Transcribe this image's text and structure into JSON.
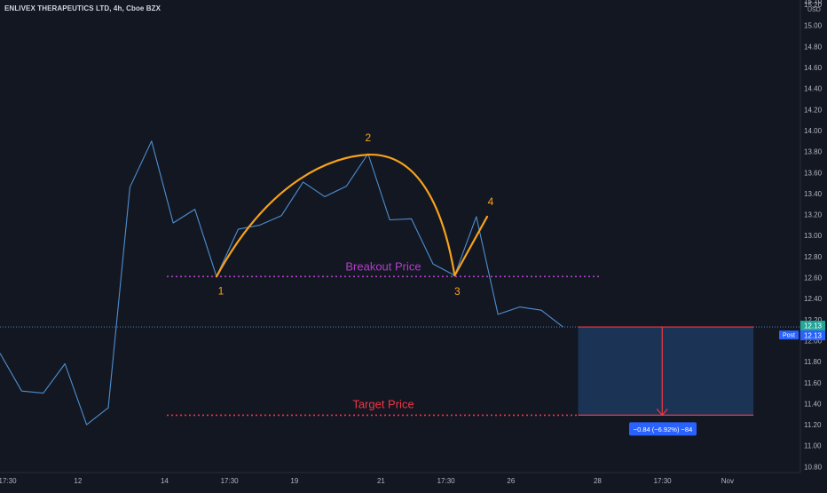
{
  "chart_data": {
    "type": "line",
    "title": "ENLIVEX THERAPEUTICS LTD, 4h, Cboe BZX",
    "currency": "USD",
    "ylim": [
      10.7,
      15.75
    ],
    "yticks": [
      10.8,
      11.0,
      11.2,
      11.4,
      11.6,
      11.8,
      12.0,
      12.2,
      12.4,
      12.6,
      12.8,
      13.0,
      13.2,
      13.4,
      13.6,
      13.8,
      14.0,
      14.2,
      14.4,
      14.6,
      14.8,
      15.0,
      15.2
    ],
    "ytick_labels": [
      "10.80",
      "11.00",
      "11.20",
      "11.40",
      "11.60",
      "11.80",
      "12.00",
      "12.20",
      "12.40",
      "12.60",
      "12.80",
      "13.00",
      "13.20",
      "13.40",
      "13.60",
      "13.80",
      "14.00",
      "14.20",
      "14.40",
      "14.60",
      "14.80",
      "15.00",
      "15.20"
    ],
    "partial_top_label": "15.70",
    "x": [
      0,
      1,
      2,
      3,
      4,
      5,
      6,
      7,
      8,
      9,
      10,
      11,
      12,
      13,
      14,
      15,
      16,
      17,
      18,
      19,
      20,
      21,
      22,
      23,
      24,
      25,
      26
    ],
    "xticks": [
      {
        "x": 0.35,
        "label": "17:30"
      },
      {
        "x": 3.6,
        "label": "12"
      },
      {
        "x": 7.6,
        "label": "14"
      },
      {
        "x": 10.6,
        "label": "17:30"
      },
      {
        "x": 13.6,
        "label": "19"
      },
      {
        "x": 17.6,
        "label": "21"
      },
      {
        "x": 20.6,
        "label": "17:30"
      },
      {
        "x": 23.6,
        "label": "26"
      },
      {
        "x": 27.6,
        "label": "28"
      },
      {
        "x": 30.6,
        "label": "17:30"
      },
      {
        "x": 33.6,
        "label": "Nov"
      }
    ],
    "xlim": [
      0,
      38
    ],
    "series": [
      {
        "color": "#4e8fd0",
        "values": [
          11.88,
          11.52,
          11.5,
          11.78,
          11.2,
          11.36,
          13.46,
          13.9,
          13.12,
          13.25,
          12.61,
          13.06,
          13.1,
          13.19,
          13.51,
          13.37,
          13.47,
          13.78,
          13.15,
          13.16,
          12.73,
          12.62,
          13.18,
          12.25,
          12.32,
          12.29,
          12.13
        ]
      }
    ],
    "last_price": 12.13,
    "last_price_label": "12.13",
    "post_label": "Post",
    "post_price_label": "12.13",
    "breakout_price": 12.61,
    "breakout_label": "Breakout Price",
    "target_price": 11.29,
    "target_label": "Target Price",
    "pattern_points": [
      {
        "label": "1",
        "x": 10,
        "y": 12.61
      },
      {
        "label": "2",
        "x": 17,
        "y": 13.77
      },
      {
        "label": "3",
        "x": 21,
        "y": 12.62
      },
      {
        "label": "4",
        "x": 22.5,
        "y": 13.18
      }
    ],
    "measure_box": {
      "x_start": 26.7,
      "x_end": 34.8,
      "top": 12.13,
      "bottom": 11.29
    },
    "measure_label": "−0.84 (−6.92%) −84",
    "colors": {
      "background": "#131722",
      "line": "#4e8fd0",
      "pattern": "#f7a21b",
      "breakout": "#b03fc6",
      "target": "#f23645",
      "axis_text": "#b2b5be",
      "label_blue": "#2962ff",
      "post_green": "#26a69a",
      "measure_fill": "#1d3a5e"
    }
  }
}
